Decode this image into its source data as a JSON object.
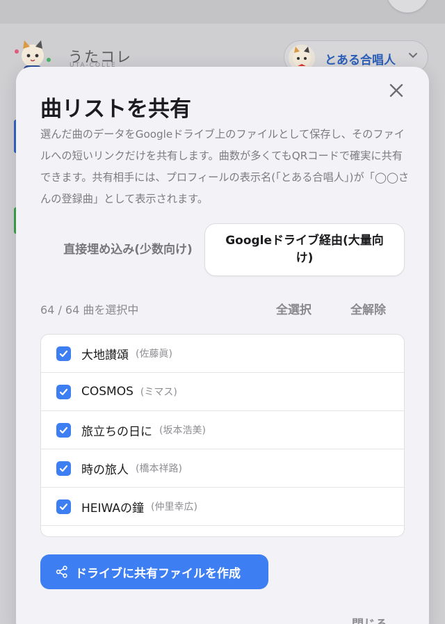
{
  "app": {
    "title": "うたコレ",
    "subtitle": "UTA-COLLE",
    "user_name": "とある合唱人"
  },
  "modal": {
    "title": "曲リストを共有",
    "description": "選んだ曲のデータをGoogleドライブ上のファイルとして保存し、そのファイルへの短いリンクだけを共有します。曲数が多くてもQRコードで確実に共有できます。共有相手には、プロフィールの表示名(「とある合唱人」)が「◯◯さんの登録曲」として表示されます。",
    "tabs": [
      {
        "label": "直接埋め込み(少数向け)",
        "active": false
      },
      {
        "label": "Googleドライブ経由(大量向け)",
        "active": true
      }
    ],
    "selection_count": "64 / 64 曲を選択中",
    "select_all": "全選択",
    "deselect_all": "全解除",
    "songs": [
      {
        "title": "大地讃頌",
        "artist": "(佐藤眞)",
        "checked": true
      },
      {
        "title": "COSMOS",
        "artist": "(ミマス)",
        "checked": true
      },
      {
        "title": "旅立ちの日に",
        "artist": "(坂本浩美)",
        "checked": true
      },
      {
        "title": "時の旅人",
        "artist": "(橋本祥路)",
        "checked": true
      },
      {
        "title": "HEIWAの鐘",
        "artist": "(仲里幸広)",
        "checked": true
      }
    ],
    "create_button": "ドライブに共有ファイルを作成",
    "close_label": "閉じる"
  },
  "colors": {
    "accent": "#3d7ef2",
    "modal_bg": "#f2f2f7",
    "user_name": "#2c5fb8"
  },
  "icons": {
    "close": "close-icon",
    "share": "share-icon",
    "check": "check-icon",
    "chevron": "chevron-down-icon"
  }
}
